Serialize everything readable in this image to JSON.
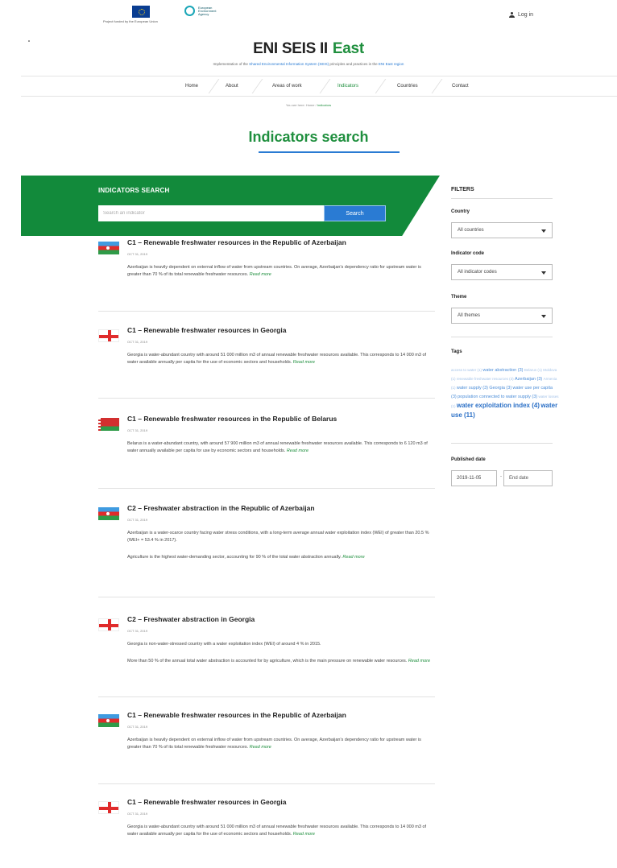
{
  "header": {
    "eu_caption": "Project funded by the European Union",
    "eea_text": "European Environment Agency",
    "login_label": "Log in"
  },
  "site": {
    "title": "ENI SEIS II",
    "title_accent": "East",
    "subtitle_prefix": "Implementation of the ",
    "subtitle_link1": "Shared Environmental Information System (SEIS)",
    "subtitle_middle": " principles and practices in the ",
    "subtitle_link2": "ENI East region"
  },
  "nav": [
    "Home",
    "About",
    "Areas of work",
    "Indicators",
    "Countries",
    "Contact"
  ],
  "breadcrumb": {
    "items": [
      "You are here:",
      "Home",
      "Indicators"
    ]
  },
  "page_title": "Indicators search",
  "search": {
    "heading": "INDICATORS SEARCH",
    "placeholder": "Search an indicator",
    "button_label": "Search"
  },
  "results": [
    {
      "flag": "azerbaijan-flag",
      "title": "C1 – Renewable freshwater resources in the Republic of Azerbaijan",
      "date": "OCT 31, 2019",
      "paragraphs": [
        "Azerbaijan is heavily dependent on external inflow of water from upstream countries. On average, Azerbaijan's dependency ratio for upstream water is greater than 70 % of its total renewable freshwater resources."
      ],
      "read_more": "Read more"
    },
    {
      "flag": "georgia-flag",
      "title": "C1 – Renewable freshwater resources in Georgia",
      "date": "OCT 31, 2019",
      "paragraphs": [
        "Georgia is water-abundant country with around 51 000 million m3 of annual renewable freshwater resources available. This corresponds to 14 000 m3 of water available annually per capita for the use of economic sectors and households."
      ],
      "read_more": "Read more"
    },
    {
      "flag": "belarus-flag",
      "title": "C1 – Renewable freshwater resources in the Republic of Belarus",
      "date": "OCT 31, 2019",
      "paragraphs": [
        "Belarus is a water-abundant country, with around 57 900 million m3 of annual renewable freshwater resources available. This corresponds to 6 120 m3 of water annually available per capita for use by economic sectors and households."
      ],
      "read_more": "Read more"
    },
    {
      "flag": "azerbaijan-flag",
      "title": "C2 – Freshwater abstraction in the Republic of Azerbaijan",
      "date": "OCT 31, 2019",
      "paragraphs": [
        "Azerbaijan is a water-scarce country facing water stress conditions, with a long-term average annual water exploitation index (WEI) of greater than 20.5 % (WEI+ = 53.4 % in 2017).",
        "Agriculture is the highest water-demanding sector, accounting for 90 % of the total water abstraction annually."
      ],
      "read_more": "Read more"
    },
    {
      "flag": "georgia-flag",
      "title": "C2 – Freshwater abstraction in Georgia",
      "date": "OCT 31, 2019",
      "paragraphs": [
        "Georgia is non-water-stressed country with a water exploitation index (WEI) of around 4 % in 2015.",
        "More than 50 % of the annual total water abstraction is accounted for by agriculture, which is the main pressure on renewable water resources."
      ],
      "read_more": "Read more"
    },
    {
      "flag": "azerbaijan-flag",
      "title": "C1 – Renewable freshwater resources in the Republic of Azerbaijan",
      "date": "OCT 31, 2019",
      "paragraphs": [
        "Azerbaijan is heavily dependent on external inflow of water from upstream countries. On average, Azerbaijan's dependency ratio for upstream water is greater than 70 % of its total renewable freshwater resources."
      ],
      "read_more": "Read more"
    },
    {
      "flag": "georgia-flag",
      "title": "C1 – Renewable freshwater resources in Georgia",
      "date": "OCT 31, 2019",
      "paragraphs": [
        "Georgia is water-abundant country with around 51 000 million m3 of annual renewable freshwater resources available. This corresponds to 14 000 m3 of water available annually per capita for the use of economic sectors and households."
      ],
      "read_more": "Read more"
    }
  ],
  "filters": {
    "heading": "FILTERS",
    "country_label": "Country",
    "country_value": "All countries",
    "code_label": "Indicator code",
    "code_value": "All indicator codes",
    "theme_label": "Theme",
    "theme_value": "All themes",
    "tags_label": "Tags",
    "tags": [
      {
        "text": "access to water (1)",
        "size": "t-sm"
      },
      {
        "text": "water abstraction (3)",
        "size": "t-md"
      },
      {
        "text": "Belarus (1)",
        "size": "t-sm"
      },
      {
        "text": "Moldova (1)",
        "size": "t-sm"
      },
      {
        "text": "renewable freshwater resources (3)",
        "size": "t-sm"
      },
      {
        "text": "Azerbaijan (3)",
        "size": "t-md"
      },
      {
        "text": "Armenia (1)",
        "size": "t-sm"
      },
      {
        "text": "water supply (3)",
        "size": "t-md"
      },
      {
        "text": "Georgia (3)",
        "size": "t-md"
      },
      {
        "text": "water use per capita (3)",
        "size": "t-md"
      },
      {
        "text": "population connected to water supply (3)",
        "size": "t-md"
      },
      {
        "text": "water losses (1)",
        "size": "t-sm"
      },
      {
        "text": "water exploitation index (4)",
        "size": "t-lg"
      },
      {
        "text": "water use (11)",
        "size": "t-lg"
      }
    ],
    "published_label": "Published date",
    "start_date": "2019-11-05",
    "date_separator": "-",
    "end_placeholder": "End date"
  }
}
